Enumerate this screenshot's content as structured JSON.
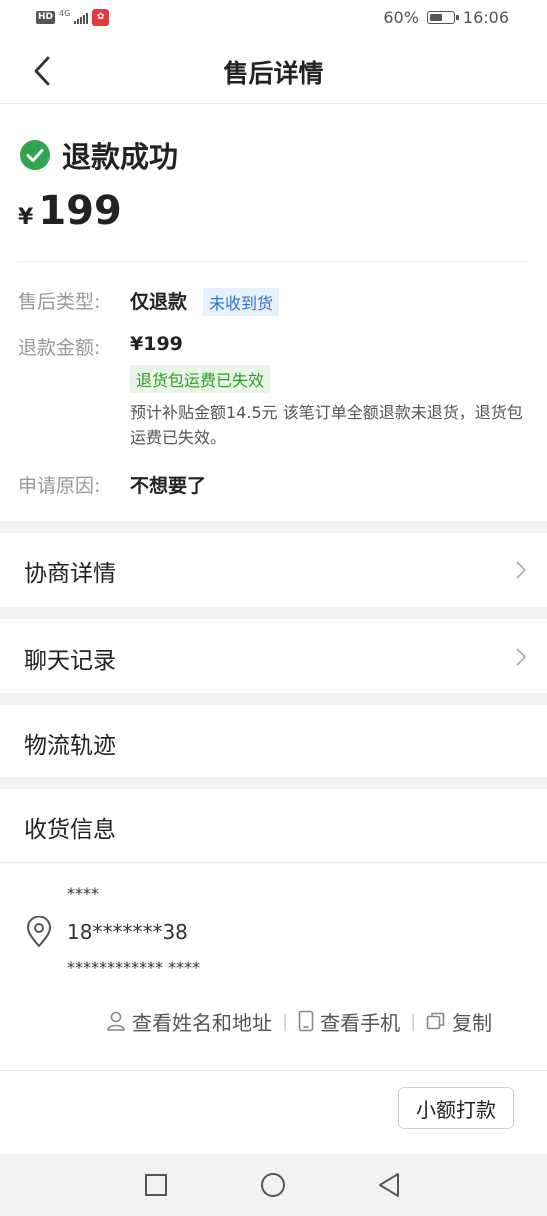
{
  "status_bar": {
    "network_hd": "HD",
    "network_type": "4G",
    "battery": "60%",
    "battery_level": 0.6,
    "time": "16:06"
  },
  "header": {
    "title": "售后详情"
  },
  "summary": {
    "status": "退款成功",
    "currency": "¥",
    "amount": "199"
  },
  "details": {
    "type_label": "售后类型:",
    "type_value": "仅退款",
    "type_tag": "未收到货",
    "amount_label": "退款金额:",
    "amount_value": "¥199",
    "shipping_tag": "退货包运费已失效",
    "note": "预计补贴金额14.5元 该笔订单全额退款未退货，退货包运费已失效。",
    "reason_label": "申请原因:",
    "reason_value": "不想要了"
  },
  "sections": {
    "negotiation": "协商详情",
    "chat": "聊天记录",
    "logistics": "物流轨迹",
    "shipping": "收货信息"
  },
  "address": {
    "name": "****",
    "phone": "18*******38",
    "detail": "************ ****"
  },
  "actions": {
    "view_name_address": "查看姓名和地址",
    "view_phone": "查看手机",
    "copy": "复制"
  },
  "footer": {
    "pay_button": "小额打款"
  },
  "colors": {
    "success_green": "#2fa44f",
    "tag_blue": "#2f74c5",
    "tag_green": "#2d9c29"
  },
  "icons": [
    "back-arrow-icon",
    "check-circle-icon",
    "chevron-right-icon",
    "location-pin-icon",
    "person-icon",
    "phone-icon",
    "copy-icon",
    "square-icon",
    "circle-icon",
    "triangle-back-icon"
  ]
}
